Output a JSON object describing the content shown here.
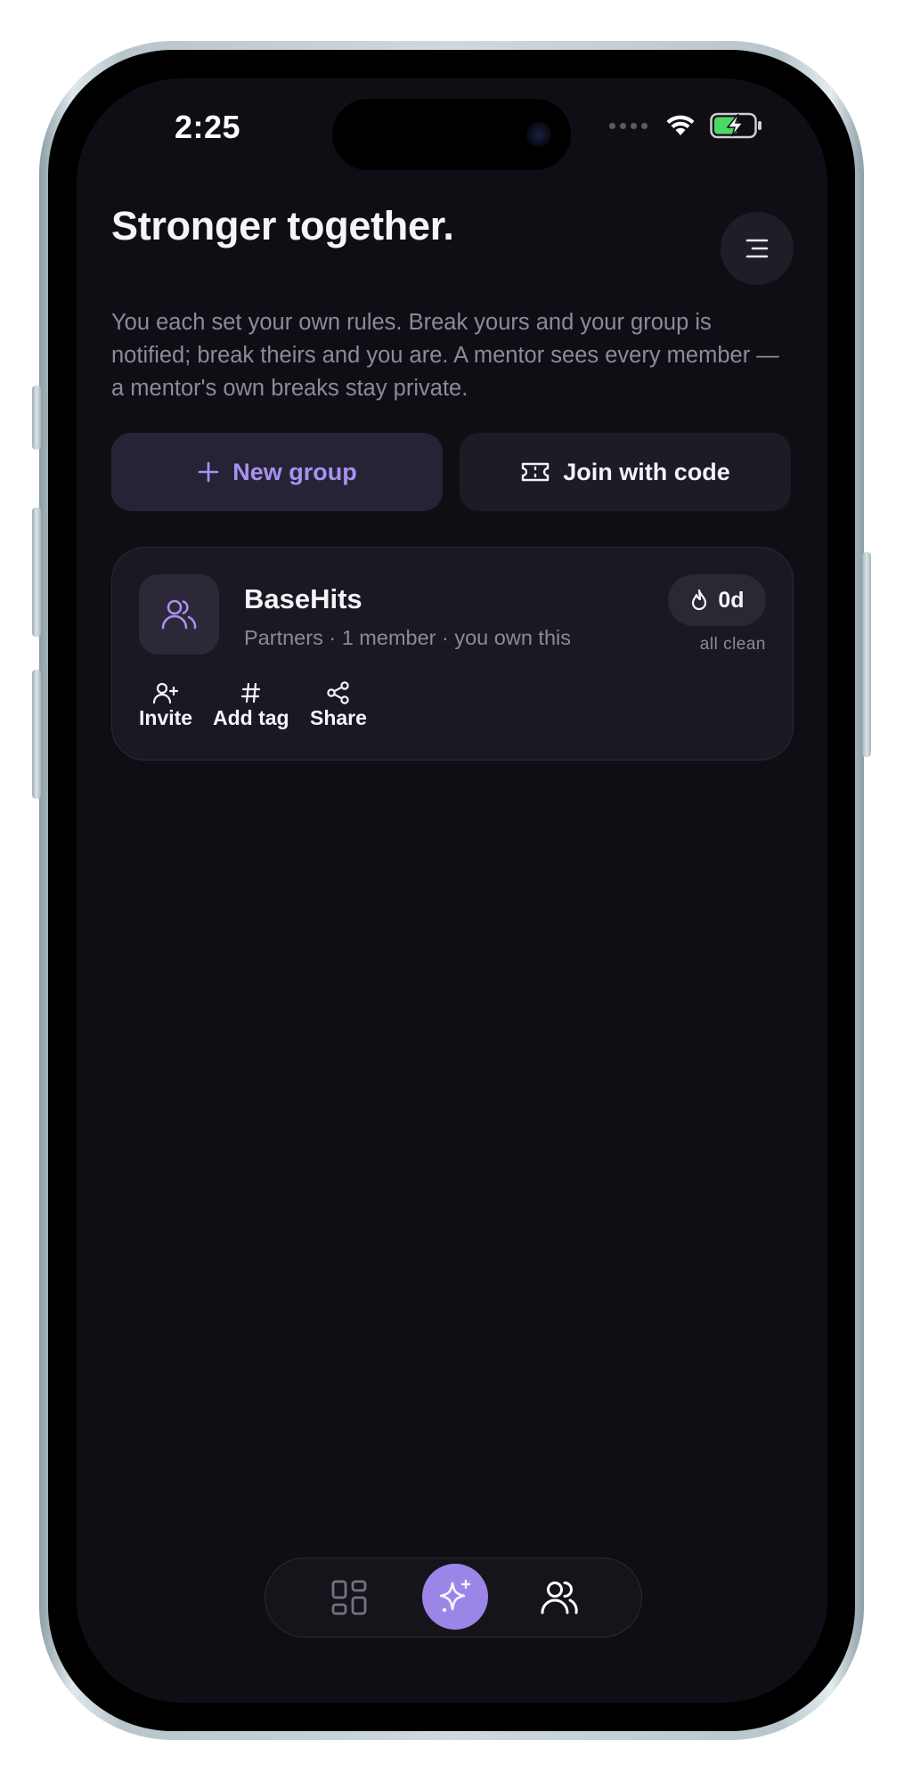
{
  "status_bar": {
    "time": "2:25",
    "icons": [
      "signal-dots-icon",
      "wifi-icon",
      "battery-charging-icon"
    ]
  },
  "header": {
    "title": "Stronger together.",
    "subtitle": "You each set your own rules. Break yours and your group is notified; break theirs and you are. A mentor sees every member — a mentor's own breaks stay private.",
    "menu_icon": "menu-icon"
  },
  "actions": {
    "new_group_label": "New group",
    "join_label": "Join with code"
  },
  "groups": [
    {
      "name": "BaseHits",
      "meta": "Partners · 1 member · you own this",
      "streak": "0d",
      "streak_label": "all clean",
      "actions": {
        "invite": "Invite",
        "add_tag": "Add tag",
        "share": "Share"
      }
    }
  ],
  "bottom_nav": {
    "items": [
      "dashboard-icon",
      "sparkle-icon",
      "users-icon"
    ],
    "active": "sparkle-icon"
  },
  "colors": {
    "background": "#0f0e15",
    "card": "#1a1821",
    "accent": "#9b86e8",
    "accent_text": "#a692f0",
    "muted_text": "#8d8a99",
    "battery_green": "#4cd964"
  }
}
